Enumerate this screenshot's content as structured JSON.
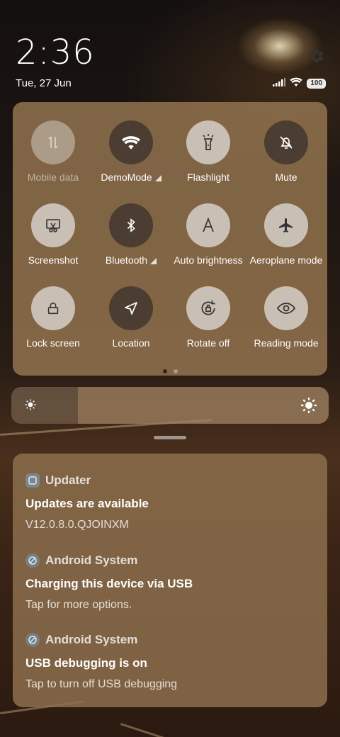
{
  "status": {
    "time": "2:36",
    "date": "Tue, 27 Jun",
    "battery": "100"
  },
  "icons": {
    "settings": "gear-icon",
    "signal": "signal-icon",
    "wifi": "wifi-icon",
    "battery": "battery-icon"
  },
  "tiles": [
    {
      "label": "Mobile data",
      "icon": "mobile-data-icon",
      "state": "disabled"
    },
    {
      "label": "DemoMode",
      "icon": "wifi-icon",
      "state": "on"
    },
    {
      "label": "Flashlight",
      "icon": "flashlight-icon",
      "state": "off"
    },
    {
      "label": "Mute",
      "icon": "bell-off-icon",
      "state": "on"
    },
    {
      "label": "Screenshot",
      "icon": "screenshot-icon",
      "state": "off"
    },
    {
      "label": "Bluetooth",
      "icon": "bluetooth-icon",
      "state": "on"
    },
    {
      "label": "Auto brightness",
      "icon": "auto-brightness-icon",
      "state": "off"
    },
    {
      "label": "Aeroplane mode",
      "icon": "airplane-icon",
      "state": "off"
    },
    {
      "label": "Lock screen",
      "icon": "lock-icon",
      "state": "off"
    },
    {
      "label": "Location",
      "icon": "location-icon",
      "state": "on"
    },
    {
      "label": "Rotate off",
      "icon": "rotate-lock-icon",
      "state": "off"
    },
    {
      "label": "Reading mode",
      "icon": "eye-icon",
      "state": "off"
    }
  ],
  "page_indicator": {
    "pages": 2,
    "current": 1
  },
  "brightness": {
    "level": 0.21
  },
  "notifications": [
    {
      "app": "Updater",
      "title": "Updates are available",
      "text": "V12.0.8.0.QJOINXM"
    },
    {
      "app": "Android System",
      "title": "Charging this device via USB",
      "text": "Tap for more options."
    },
    {
      "app": "Android System",
      "title": "USB debugging is on",
      "text": "Tap to turn off USB debugging"
    }
  ]
}
